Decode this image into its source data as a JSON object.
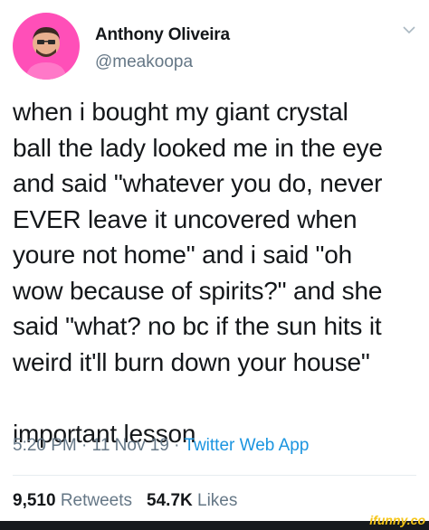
{
  "author": {
    "name": "Anthony Oliveira",
    "handle": "@meakoopa",
    "avatar_icon": "profile-photo"
  },
  "menu_icon": "chevron-down-icon",
  "tweet": {
    "lines": [
      "when i bought my giant crystal",
      "ball the lady looked me in the eye",
      "and said \"whatever you do, never",
      "EVER leave it uncovered when",
      "youre not home\" and i said \"oh",
      "wow because of spirits?\" and she",
      "said \"what? no bc if the sun hits it",
      "weird it'll burn down your house\""
    ],
    "closing": "important lesson"
  },
  "meta": {
    "time": "5:20 PM",
    "sep1": " · ",
    "date": "11 Nov 19",
    "sep2": " · ",
    "app": "Twitter Web App"
  },
  "stats": {
    "retweets_count": "9,510",
    "retweets_label": "Retweets",
    "likes_count": "54.7K",
    "likes_label": "Likes"
  },
  "watermark": "ifunny.co",
  "colors": {
    "text": "#14171a",
    "secondary": "#657786",
    "link": "#1b95e0",
    "avatar_bg": "#ff4fb8"
  }
}
